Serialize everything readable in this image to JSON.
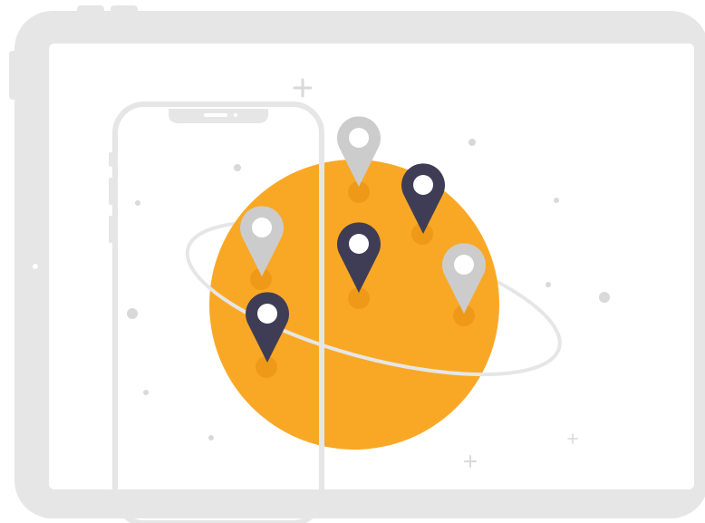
{
  "illustration": {
    "subject": "",
    "colors": {
      "device_frame": "#e6e6e6",
      "device_screen": "#ffffff",
      "planet": "#f9a826",
      "planet_shadow": "#ee9a18",
      "orbit_ring": "#e6e6e6",
      "pin_dark": "#3f3d56",
      "pin_light": "#cccccc",
      "pin_hole": "#ffffff",
      "decor": "#d9d9d9"
    },
    "icons": [
      "tablet-icon",
      "phone-icon",
      "planet-icon",
      "map-pin-icon"
    ]
  },
  "pins": [
    {
      "variant": "light"
    },
    {
      "variant": "dark"
    },
    {
      "variant": "light"
    },
    {
      "variant": "dark"
    },
    {
      "variant": "light"
    },
    {
      "variant": "dark"
    }
  ]
}
